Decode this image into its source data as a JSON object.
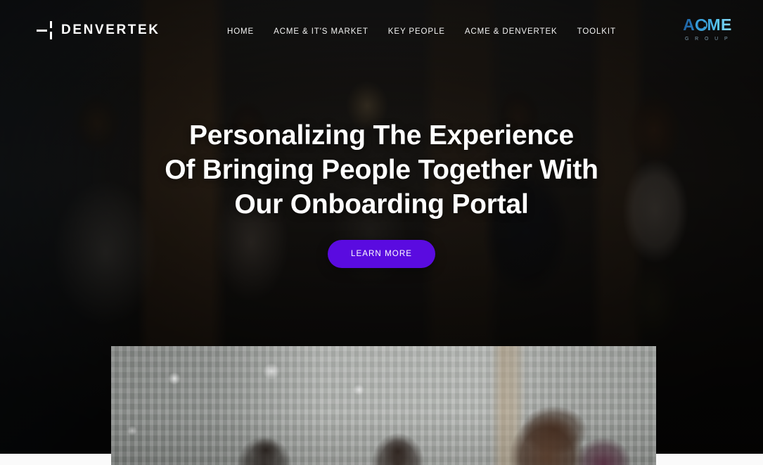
{
  "header": {
    "brand": {
      "name": "DENVERTEK",
      "mark_icon": "denvertek-dash-mark-icon"
    },
    "nav": [
      {
        "label": "HOME",
        "name": "nav-home"
      },
      {
        "label": "ACME & IT'S MARKET",
        "name": "nav-acme-its-market"
      },
      {
        "label": "KEY PEOPLE",
        "name": "nav-key-people"
      },
      {
        "label": "ACME & DENVERTEK",
        "name": "nav-acme-denvertek"
      },
      {
        "label": "TOOLKIT",
        "name": "nav-toolkit"
      }
    ],
    "partner_logo": {
      "word": "ACME",
      "subtitle": "G R O U P",
      "ring_icon": "acme-circle-icon"
    }
  },
  "hero": {
    "title_line1": "Personalizing The Experience",
    "title_line2": "Of Bringing People Together With",
    "title_line3": "Our Onboarding Portal",
    "cta_label": "LEARN MORE",
    "background_alt": "office-team-standing-photo"
  },
  "feature": {
    "image_alt": "meeting-room-colleagues-photo"
  },
  "colors": {
    "cta_purple": "#5A0BE0",
    "text_white": "#FFFFFF",
    "nav_text": "#F2F2F2",
    "page_background": "#FAFAFA",
    "acme_blue": "#3FA7DD",
    "acme_blue_dark": "#1E5F9E"
  }
}
